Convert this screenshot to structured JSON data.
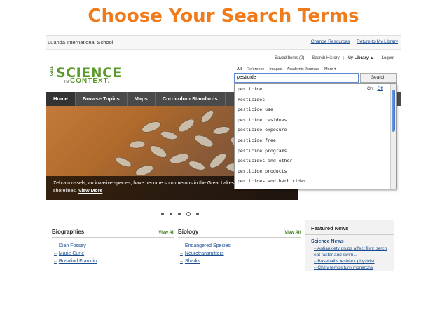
{
  "slide_title": "Choose Your Search Terms",
  "topbar": {
    "school": "Luanda International School",
    "change_resources": "Change Resources",
    "return_library": "Return to My Library"
  },
  "util": {
    "saved_items": "Saved Items (0)",
    "search_history": "Search History",
    "my_library": "My Library ▲",
    "logout": "Logout"
  },
  "logo": {
    "gale": "GALE",
    "science": "SCIENCE",
    "in": "IN",
    "context": "CONTEXT."
  },
  "search": {
    "tabs": [
      "All",
      "Reference",
      "Images",
      "Academic Journals",
      "More ▾"
    ],
    "value": "pesticide",
    "button": "Search"
  },
  "autocomplete": {
    "on": "On",
    "off": "Off",
    "items": [
      "pesticide",
      "Pesticides",
      "pesticide use",
      "pesticide residues",
      "pesticide exposure",
      "pesticide free",
      "pesticide programs",
      "pesticides and other",
      "pesticide products",
      "pesticides and herbicides"
    ]
  },
  "nav": [
    "Home",
    "Browse Topics",
    "Maps",
    "Curriculum Standards"
  ],
  "hero": {
    "caption": "Zebra mussels, an invasive species, have become so numerous in the Great Lakes that they collect on shorelines.",
    "more": "View More"
  },
  "biographies": {
    "title": "Biographies",
    "view_all": "View All",
    "items": [
      "Dian Fossey",
      "Marie Curie",
      "Rosalind Franklin"
    ]
  },
  "biology": {
    "title": "Biology",
    "view_all": "View All",
    "items": [
      "Endangered Species",
      "Neurotransmitters",
      "Sharks"
    ]
  },
  "featured": {
    "title": "Featured News",
    "sub": "Science News",
    "items": [
      "Antianxiety drugs affect fish: perch eat faster and swim...",
      "Baseball's resident physicist",
      "Chilly temps turn monarchs"
    ]
  }
}
